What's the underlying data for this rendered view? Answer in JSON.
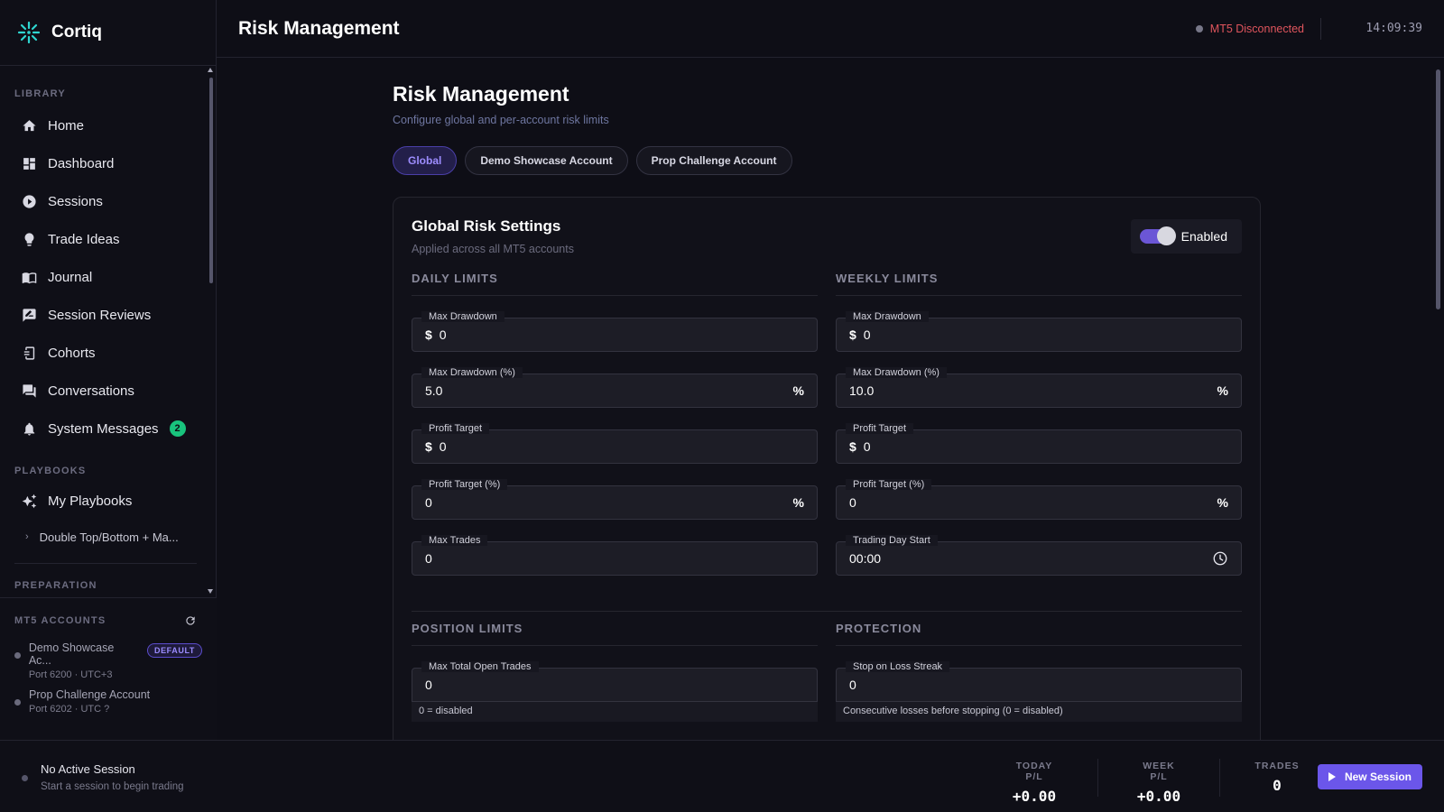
{
  "app": {
    "name": "Cortiq"
  },
  "sidebar": {
    "library_title": "LIBRARY",
    "items": [
      {
        "label": "Home",
        "icon": "home-icon"
      },
      {
        "label": "Dashboard",
        "icon": "dashboard-icon"
      },
      {
        "label": "Sessions",
        "icon": "play-circle-icon"
      },
      {
        "label": "Trade Ideas",
        "icon": "lightbulb-icon"
      },
      {
        "label": "Journal",
        "icon": "book-icon"
      },
      {
        "label": "Session Reviews",
        "icon": "rate-review-icon"
      },
      {
        "label": "Cohorts",
        "icon": "cohort-icon"
      },
      {
        "label": "Conversations",
        "icon": "chat-icon"
      },
      {
        "label": "System Messages",
        "icon": "bell-icon",
        "badge": "2"
      }
    ],
    "playbooks_title": "PLAYBOOKS",
    "my_playbooks": "My Playbooks",
    "playbook_sub": "Double Top/Bottom + Ma...",
    "cut_section": "PREPARATION"
  },
  "mt5": {
    "title": "MT5 ACCOUNTS",
    "accounts": [
      {
        "name": "Demo Showcase Ac...",
        "meta": "Port 6200 · UTC+3",
        "badge": "DEFAULT"
      },
      {
        "name": "Prop Challenge Account",
        "meta": "Port 6202 · UTC ?"
      }
    ]
  },
  "topbar": {
    "title": "Risk Management",
    "status": "MT5 Disconnected",
    "clock": "14:09:39"
  },
  "page": {
    "title": "Risk Management",
    "subtitle": "Configure global and per-account risk limits",
    "tabs": [
      "Global",
      "Demo Showcase Account",
      "Prop Challenge Account"
    ],
    "active_tab": "Global"
  },
  "card": {
    "title": "Global Risk Settings",
    "subtitle": "Applied across all MT5 accounts",
    "toggle_label": "Enabled",
    "daily": {
      "title": "DAILY LIMITS",
      "fields": [
        {
          "label": "Max Drawdown",
          "prefix": "$",
          "value": "0"
        },
        {
          "label": "Max Drawdown (%)",
          "value": "5.0",
          "suffix": "%"
        },
        {
          "label": "Profit Target",
          "prefix": "$",
          "value": "0"
        },
        {
          "label": "Profit Target (%)",
          "value": "0",
          "suffix": "%"
        },
        {
          "label": "Max Trades",
          "value": "0"
        }
      ]
    },
    "weekly": {
      "title": "WEEKLY LIMITS",
      "fields": [
        {
          "label": "Max Drawdown",
          "prefix": "$",
          "value": "0"
        },
        {
          "label": "Max Drawdown (%)",
          "value": "10.0",
          "suffix": "%"
        },
        {
          "label": "Profit Target",
          "prefix": "$",
          "value": "0"
        },
        {
          "label": "Profit Target (%)",
          "value": "0",
          "suffix": "%"
        },
        {
          "label": "Trading Day Start",
          "value": "00:00"
        }
      ]
    },
    "position": {
      "title": "POSITION LIMITS",
      "label": "Max Total Open Trades",
      "value": "0",
      "helper": "0 = disabled"
    },
    "protection": {
      "title": "PROTECTION",
      "label": "Stop on Loss Streak",
      "value": "0",
      "helper": "Consecutive losses before stopping (0 = disabled)"
    }
  },
  "bottom": {
    "session_title": "No Active Session",
    "session_sub": "Start a session to begin trading",
    "today_label": "TODAY P/L",
    "today_value": "+0.00",
    "week_label": "WEEK P/L",
    "week_value": "+0.00",
    "trades_label": "TRADES",
    "trades_value": "0",
    "new_session": "New Session"
  }
}
